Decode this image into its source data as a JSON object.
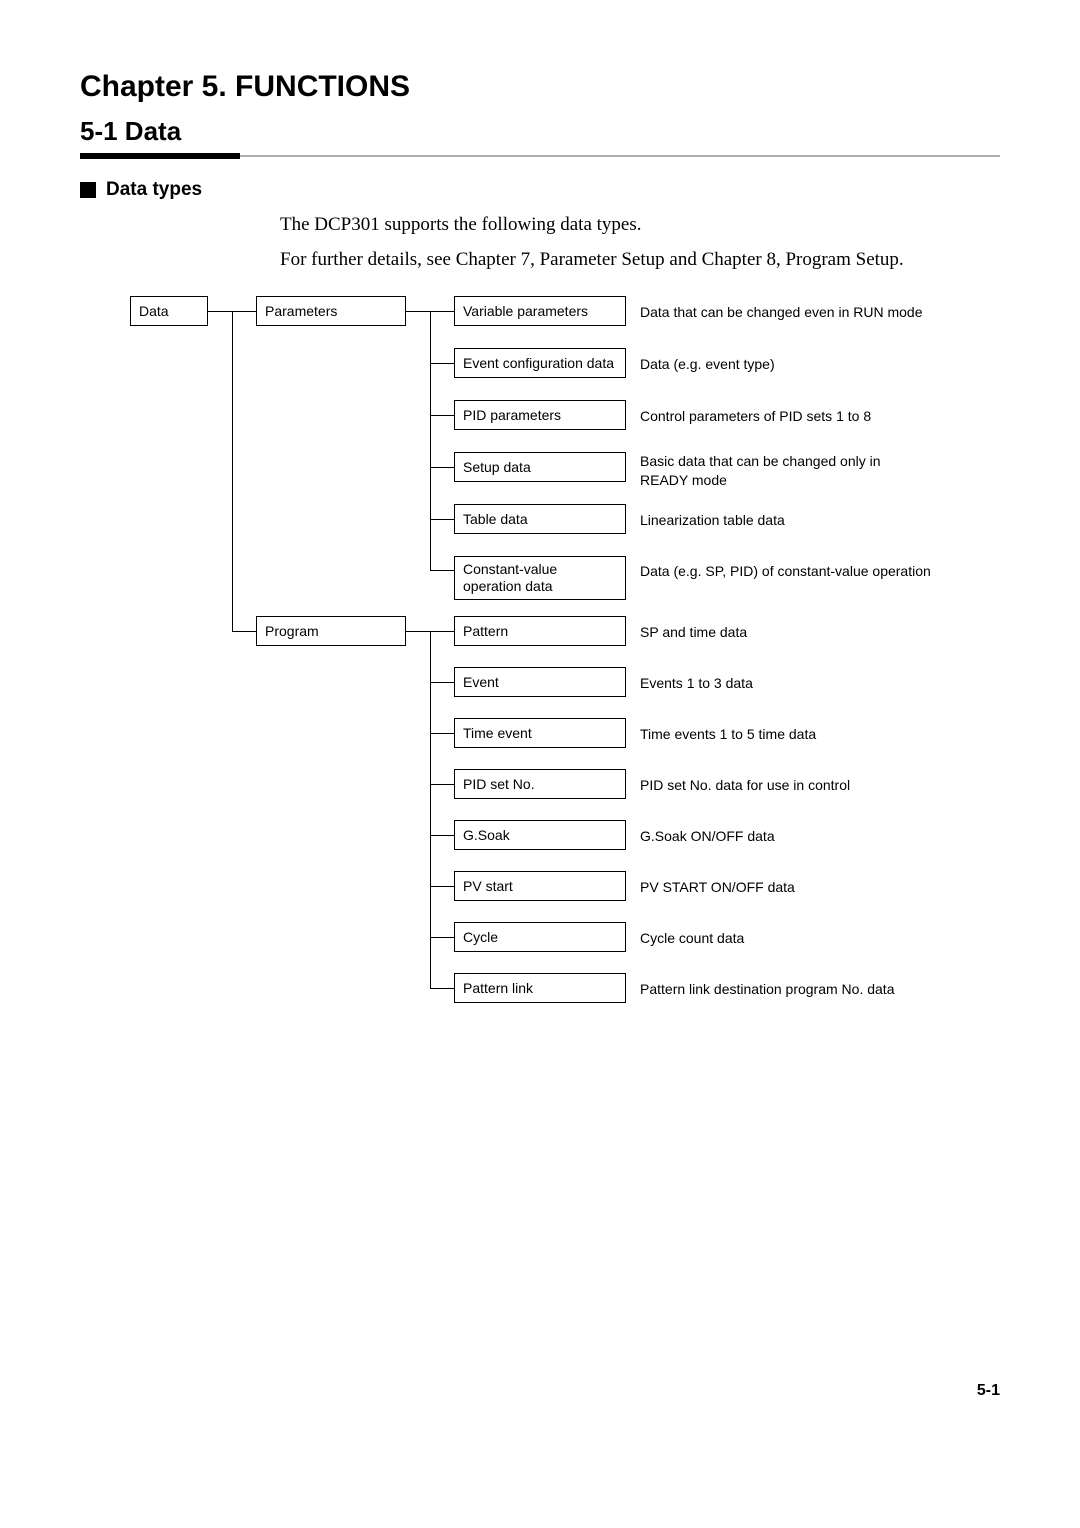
{
  "chapter_title": "Chapter 5.   FUNCTIONS",
  "section_title": "5-1    Data",
  "subheading": "Data types",
  "body_line1": "The DCP301 supports the following data types.",
  "body_line2": "For further details, see Chapter 7, Parameter Setup and Chapter 8, Program Setup.",
  "page_number": "5-1",
  "root_box": "Data",
  "level2": {
    "parameters": "Parameters",
    "program": "Program"
  },
  "parameters_children": [
    {
      "box": "Variable parameters",
      "desc": "Data that can be changed even in RUN mode"
    },
    {
      "box": "Event configuration data",
      "desc": "Data (e.g. event type)"
    },
    {
      "box": "PID parameters",
      "desc": "Control parameters of PID sets 1 to 8"
    },
    {
      "box": "Setup data",
      "desc": "Basic data that can be changed only in READY mode"
    },
    {
      "box": "Table data",
      "desc": "Linearization table data"
    },
    {
      "box": "Constant-value operation data",
      "desc": "Data (e.g. SP, PID) of constant-value operation"
    }
  ],
  "program_children": [
    {
      "box": "Pattern",
      "desc": "SP and time data"
    },
    {
      "box": "Event",
      "desc": "Events 1 to 3 data"
    },
    {
      "box": "Time event",
      "desc": "Time events 1 to 5 time data"
    },
    {
      "box": "PID set No.",
      "desc": "PID set No. data for use in control"
    },
    {
      "box": "G.Soak",
      "desc": "G.Soak ON/OFF data"
    },
    {
      "box": "PV start",
      "desc": "PV START ON/OFF data"
    },
    {
      "box": "Cycle",
      "desc": "Cycle count data"
    },
    {
      "box": "Pattern link",
      "desc": "Pattern link destination program No. data"
    }
  ]
}
